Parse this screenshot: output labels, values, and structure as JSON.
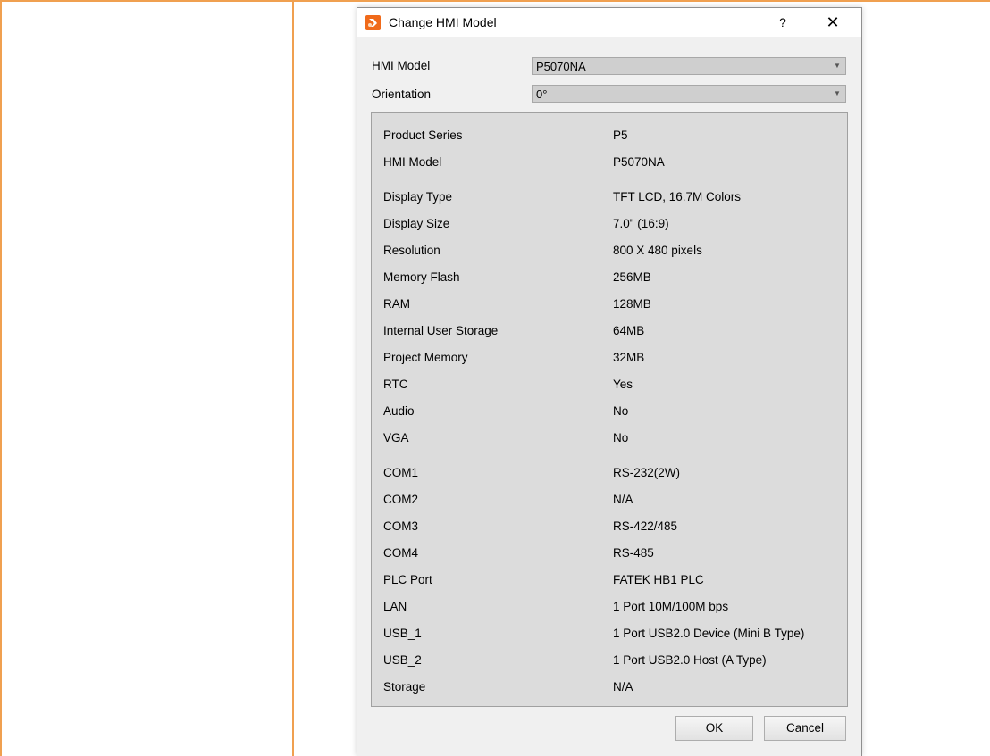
{
  "dialog": {
    "title": "Change HMI Model",
    "help_label": "?",
    "close_label": "✕"
  },
  "form": {
    "hmi_model_label": "HMI Model",
    "hmi_model_value": "P5070NA",
    "orientation_label": "Orientation",
    "orientation_value": "0°"
  },
  "specs": [
    {
      "key": "Product Series",
      "value": "P5"
    },
    {
      "key": "HMI Model",
      "value": "P5070NA"
    },
    {
      "key": "Display Type",
      "value": "TFT LCD, 16.7M Colors"
    },
    {
      "key": "Display Size",
      "value": "7.0\" (16:9)"
    },
    {
      "key": "Resolution",
      "value": "800 X 480 pixels"
    },
    {
      "key": "Memory Flash",
      "value": "256MB"
    },
    {
      "key": "RAM",
      "value": "128MB"
    },
    {
      "key": "Internal User Storage",
      "value": "64MB"
    },
    {
      "key": "Project Memory",
      "value": "32MB"
    },
    {
      "key": "RTC",
      "value": "Yes"
    },
    {
      "key": "Audio",
      "value": "No"
    },
    {
      "key": "VGA",
      "value": "No"
    },
    {
      "key": "COM1",
      "value": "RS-232(2W)"
    },
    {
      "key": "COM2",
      "value": "N/A"
    },
    {
      "key": "COM3",
      "value": "RS-422/485"
    },
    {
      "key": "COM4",
      "value": "RS-485"
    },
    {
      "key": "PLC Port",
      "value": "FATEK HB1 PLC"
    },
    {
      "key": "LAN",
      "value": "1 Port 10M/100M bps"
    },
    {
      "key": "USB_1",
      "value": "1 Port USB2.0 Device (Mini B Type)"
    },
    {
      "key": "USB_2",
      "value": "1 Port USB2.0 Host (A Type)"
    },
    {
      "key": "Storage",
      "value": "N/A"
    }
  ],
  "buttons": {
    "ok": "OK",
    "cancel": "Cancel"
  },
  "colors": {
    "accent_border": "#f0a050",
    "app_icon": "#f06a1a"
  }
}
